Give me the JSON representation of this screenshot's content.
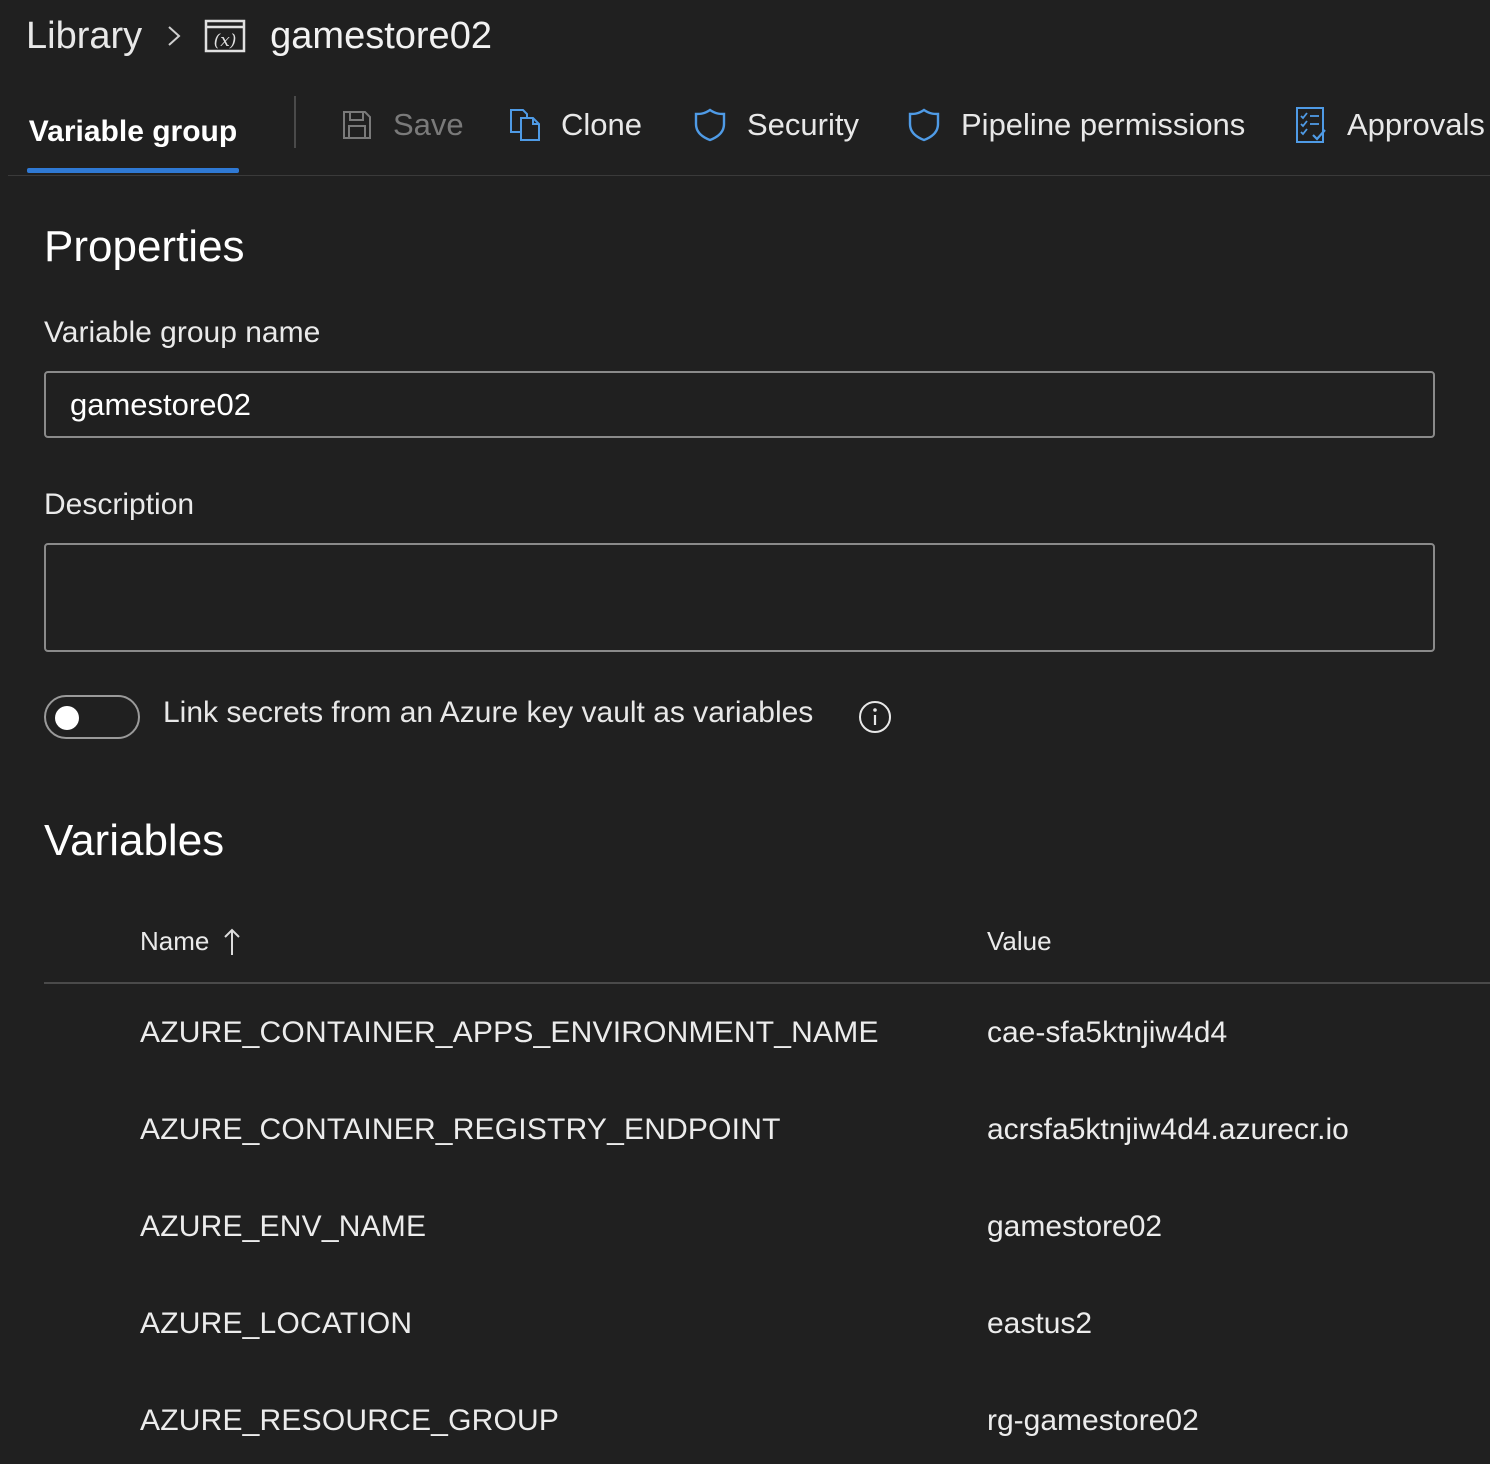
{
  "breadcrumb": {
    "root": "Library",
    "separator_icon": "chevron-right-icon",
    "group_icon": "variable-group-icon",
    "current": "gamestore02"
  },
  "toolbar": {
    "active_tab": "Variable group",
    "save_label": "Save",
    "clone_label": "Clone",
    "security_label": "Security",
    "pipeline_permissions_label": "Pipeline permissions",
    "approvals_label": "Approvals",
    "accent_color": "#2f79d4"
  },
  "properties": {
    "title": "Properties",
    "name_label": "Variable group name",
    "name_value": "gamestore02",
    "description_label": "Description",
    "description_value": "",
    "keyvault_toggle_label": "Link secrets from an Azure key vault as variables",
    "keyvault_toggle_on": false
  },
  "variables": {
    "title": "Variables",
    "columns": {
      "name": "Name",
      "value": "Value"
    },
    "sort": "name-ascending",
    "rows": [
      {
        "name": "AZURE_CONTAINER_APPS_ENVIRONMENT_NAME",
        "value": "cae-sfa5ktnjiw4d4"
      },
      {
        "name": "AZURE_CONTAINER_REGISTRY_ENDPOINT",
        "value": "acrsfa5ktnjiw4d4.azurecr.io"
      },
      {
        "name": "AZURE_ENV_NAME",
        "value": "gamestore02"
      },
      {
        "name": "AZURE_LOCATION",
        "value": "eastus2"
      },
      {
        "name": "AZURE_RESOURCE_GROUP",
        "value": "rg-gamestore02"
      }
    ]
  }
}
